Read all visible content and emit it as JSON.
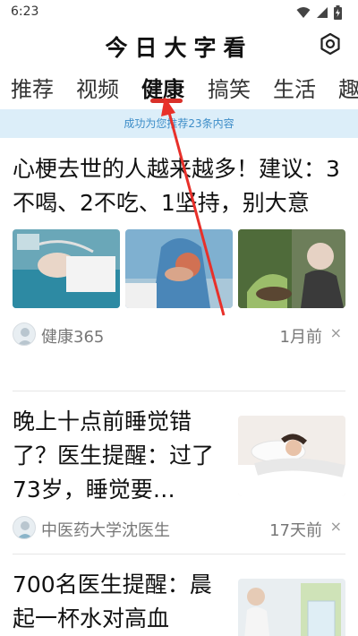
{
  "status_bar": {
    "time": "6:23"
  },
  "header": {
    "title": "今日大字看"
  },
  "tabs": [
    {
      "label": "推荐",
      "active": false
    },
    {
      "label": "视频",
      "active": false
    },
    {
      "label": "健康",
      "active": true
    },
    {
      "label": "搞笑",
      "active": false
    },
    {
      "label": "生活",
      "active": false
    },
    {
      "label": "趣",
      "active": false
    }
  ],
  "banner": {
    "text": "成功为您推荐23条内容"
  },
  "articles": [
    {
      "title": "心梗去世的人越来越多！建议：3不喝、2不吃、1坚持，别大意",
      "source": "健康365",
      "time": "1月前",
      "close": "×"
    },
    {
      "title": "晚上十点前睡觉错了？医生提醒：过了73岁，睡觉要…",
      "source": "中医药大学沈医生",
      "time": "17天前",
      "close": "×"
    },
    {
      "title": "700名医生提醒：晨起一杯水对高血"
    }
  ],
  "colors": {
    "accent": "#d9312a",
    "banner_bg": "#dceef9",
    "banner_text": "#3d8dc8"
  }
}
